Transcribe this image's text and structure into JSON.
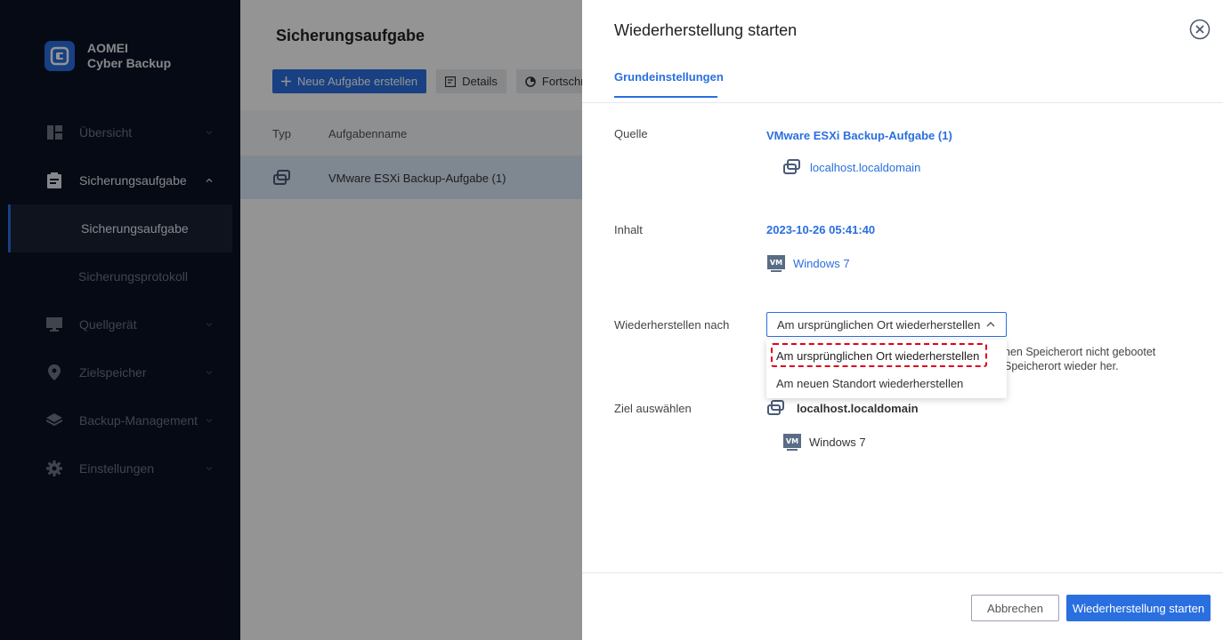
{
  "app": {
    "brand_line1": "AOMEI",
    "brand_line2": "Cyber Backup"
  },
  "sidebar": {
    "items": [
      {
        "label": "Übersicht",
        "icon": "dashboard-icon"
      },
      {
        "label": "Sicherungsaufgabe",
        "icon": "clipboard-icon",
        "expanded": true
      },
      {
        "label": "Quellgerät",
        "icon": "monitor-icon"
      },
      {
        "label": "Zielspeicher",
        "icon": "location-pin-icon"
      },
      {
        "label": "Backup-Management",
        "icon": "layers-icon"
      },
      {
        "label": "Einstellungen",
        "icon": "gear-icon"
      }
    ],
    "subitems": [
      {
        "label": "Sicherungsaufgabe",
        "active": true
      },
      {
        "label": "Sicherungsprotokoll",
        "active": false
      }
    ]
  },
  "main": {
    "title": "Sicherungsaufgabe",
    "toolbar": {
      "new_task": "Neue Aufgabe erstellen",
      "details": "Details",
      "progress": "Fortschri"
    },
    "table": {
      "columns": [
        "Typ",
        "Aufgabenname"
      ],
      "rows": [
        {
          "type_icon": "vmware-icon",
          "name": "VMware ESXi Backup-Aufgabe (1)"
        }
      ]
    }
  },
  "drawer": {
    "title": "Wiederherstellung starten",
    "tab": "Grundeinstellungen",
    "source_label": "Quelle",
    "source_task": "VMware ESXi Backup-Aufgabe (1)",
    "source_host": "localhost.localdomain",
    "content_label": "Inhalt",
    "content_date": "2023-10-26 05:41:40",
    "content_vm": "Windows 7",
    "restore_to_label": "Wiederherstellen nach",
    "restore_to_value": "Am ursprünglichen Ort wiederherstellen",
    "restore_options": [
      "Am ursprünglichen Ort wiederherstellen",
      "Am neuen Standort wiederherstellen"
    ],
    "hint_line1": "nen Speicherort nicht gebootet",
    "hint_line2": "Speicherort wieder her.",
    "target_label": "Ziel auswählen",
    "target_host": "localhost.localdomain",
    "target_vm": "Windows 7",
    "vm_badge": "VM",
    "cancel": "Abbrechen",
    "start": "Wiederherstellung starten"
  },
  "colors": {
    "accent": "#2a6fe0",
    "sidebar_bg": "#0c1223",
    "highlight_dash": "#e0001b"
  }
}
